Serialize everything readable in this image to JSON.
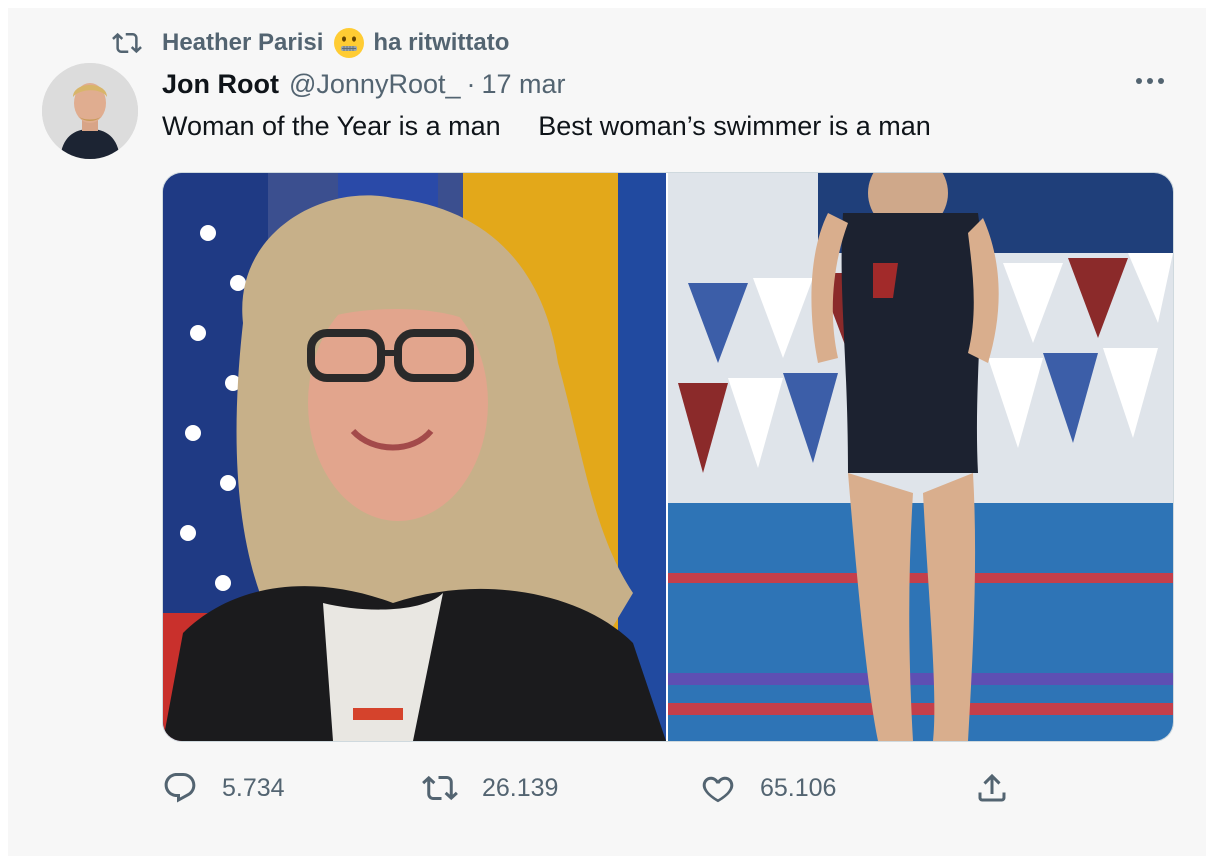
{
  "retweet_context": {
    "icon": "retweet-icon",
    "user": "Heather Parisi",
    "emoji": "zipper-mouth-face",
    "action": "ha ritwittato"
  },
  "author": {
    "name": "Jon Root",
    "handle": "@JonnyRoot_",
    "separator": "·",
    "date": "17 mar",
    "avatar": "avatar-photo"
  },
  "tweet": {
    "text": "Woman of the Year is a man     Best woman’s swimmer is a man"
  },
  "media": [
    {
      "kind": "photo",
      "subject": "person with long curly hair and glasses in front of flags"
    },
    {
      "kind": "photo",
      "subject": "swimmer standing on pool deck"
    }
  ],
  "actions": {
    "reply_count": "5.734",
    "retweet_count": "26.139",
    "like_count": "65.106",
    "share": "share-icon"
  },
  "colors": {
    "muted_text": "#536471",
    "main_text": "#0f1419",
    "background": "#f7f7f7"
  }
}
